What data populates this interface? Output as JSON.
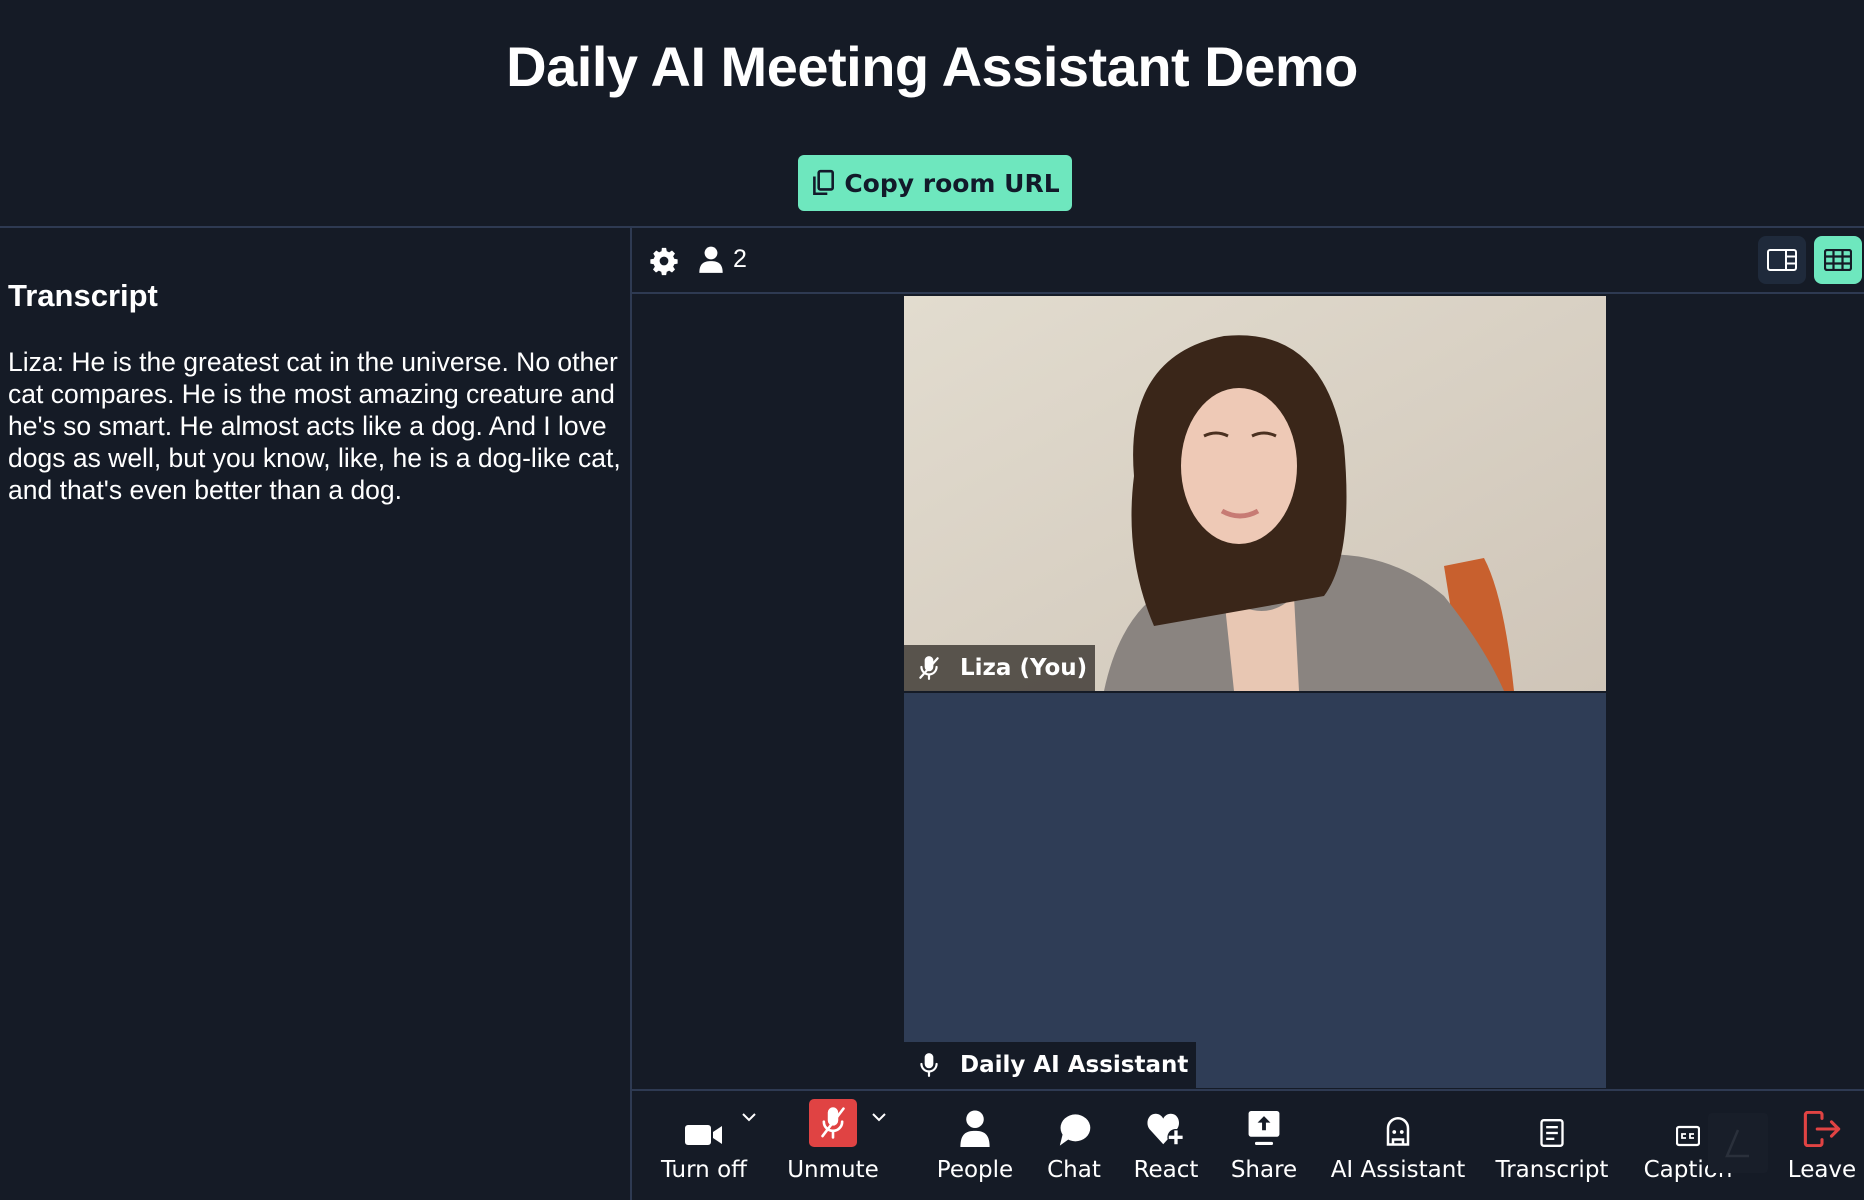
{
  "header": {
    "title": "Daily AI Meeting Assistant Demo",
    "copy_button_label": "Copy room URL",
    "copy_icon": "copy-icon"
  },
  "transcript": {
    "title": "Transcript",
    "text": "Liza: He is the greatest cat in the universe. No other cat compares. He is the most amazing creature and he's so smart. He almost acts like a dog. And I love dogs as well, but you know, like, he is a dog-like cat, and that's even better than a dog."
  },
  "toolbar": {
    "settings_icon": "gear-icon",
    "participant_icon": "person-icon",
    "participant_count": "2",
    "view_modes": [
      {
        "name": "sidebar-view",
        "icon": "sidebar-layout-icon",
        "active": false
      },
      {
        "name": "grid-view",
        "icon": "grid-layout-icon",
        "active": true
      }
    ]
  },
  "tiles": [
    {
      "name": "Liza (You)",
      "mic": "muted",
      "video": "on"
    },
    {
      "name": "Daily AI Assistant",
      "mic": "on",
      "video": "off"
    }
  ],
  "controls": [
    {
      "label": "Turn off",
      "icon": "camera-icon",
      "has_menu": true
    },
    {
      "label": "Unmute",
      "icon": "mic-muted-icon",
      "has_menu": true,
      "state": "muted"
    },
    {
      "label": "People",
      "icon": "person-icon"
    },
    {
      "label": "Chat",
      "icon": "chat-bubble-icon"
    },
    {
      "label": "React",
      "icon": "heart-plus-icon"
    },
    {
      "label": "Share",
      "icon": "share-screen-icon"
    },
    {
      "label": "AI Assistant",
      "icon": "robot-icon"
    },
    {
      "label": "Transcript",
      "icon": "document-icon"
    },
    {
      "label": "Caption",
      "icon": "closed-caption-icon"
    },
    {
      "label": "Leave",
      "icon": "leave-icon"
    }
  ],
  "colors": {
    "background": "#151b26",
    "accent": "#6ee7be",
    "danger": "#e04343",
    "border": "#2e3a52",
    "tile_off": "#2f3d56"
  }
}
